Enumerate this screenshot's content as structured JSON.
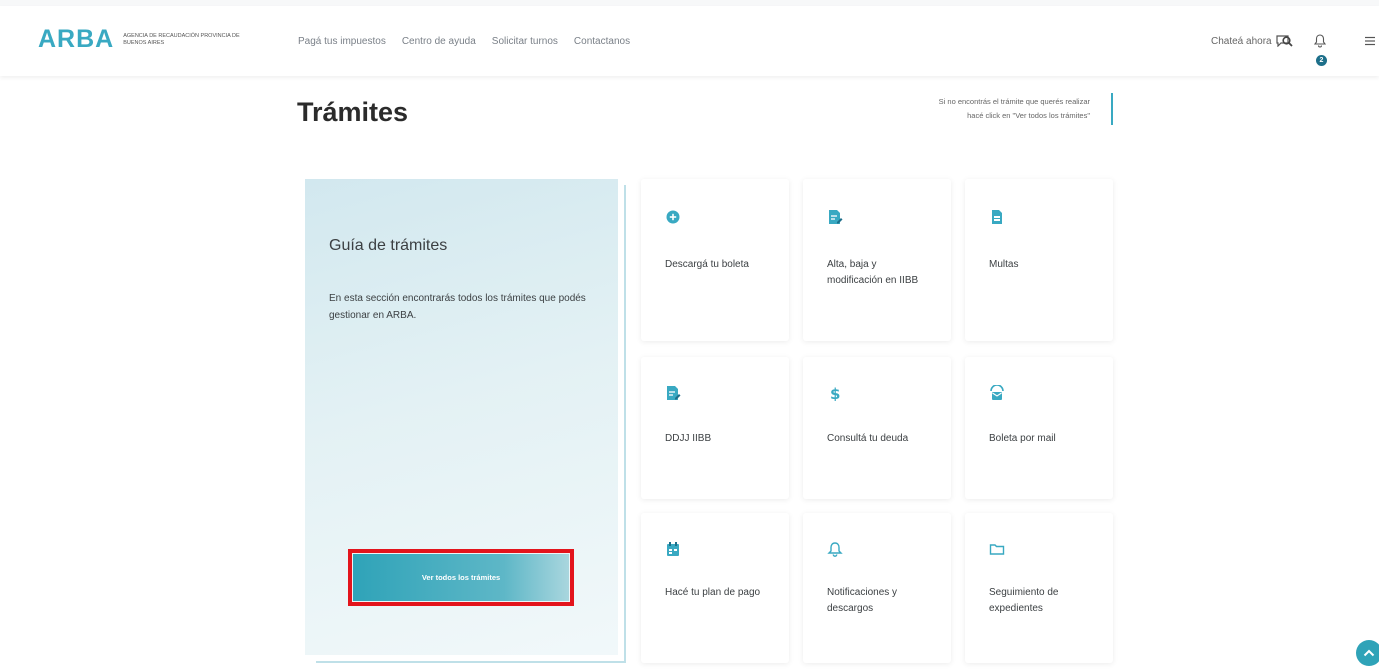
{
  "header": {
    "logo_text": "ARBA",
    "logo_subtitle": "Agencia de Recaudación Provincia de Buenos Aires",
    "nav": [
      "Pagá tus impuestos",
      "Centro de ayuda",
      "Solicitar turnos",
      "Contactanos"
    ],
    "chat_label": "Chateá ahora",
    "notification_count": "2"
  },
  "page": {
    "title": "Trámites",
    "hint_line1": "Si no encontrás el trámite que querés realizar",
    "hint_line2": "hacé click en \"Ver todos los trámites\""
  },
  "guide": {
    "title": "Guía de trámites",
    "description": "En esta sección encontrarás todos los trámites que podés gestionar en ARBA.",
    "button_label": "Ver todos los trámites"
  },
  "cards": [
    {
      "label": "Descargá tu boleta",
      "icon": "plus-circle-icon"
    },
    {
      "label": "Alta, baja y modificación en IIBB",
      "icon": "document-edit-icon"
    },
    {
      "label": "Multas",
      "icon": "document-icon"
    },
    {
      "label": "DDJJ IIBB",
      "icon": "document-edit-icon"
    },
    {
      "label": "Consultá tu deuda",
      "icon": "dollar-icon"
    },
    {
      "label": "Boleta por mail",
      "icon": "mail-icon"
    },
    {
      "label": "Hacé tu plan de pago",
      "icon": "calendar-icon"
    },
    {
      "label": "Notificaciones y descargos",
      "icon": "bell-icon"
    },
    {
      "label": "Seguimiento de expedientes",
      "icon": "folder-icon"
    }
  ],
  "colors": {
    "brand": "#39a9c2",
    "accent_dark": "#1d6f8a",
    "highlight_frame": "#e3141c"
  }
}
